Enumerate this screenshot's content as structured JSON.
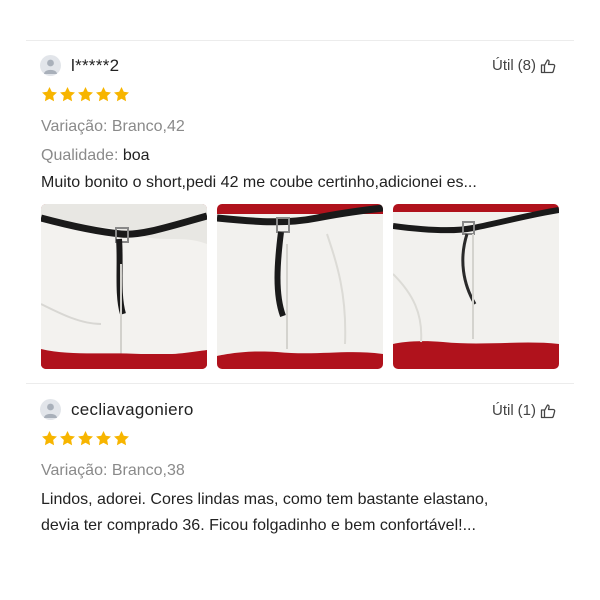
{
  "reviews": [
    {
      "username": "l*****2",
      "helpful_label": "Útil",
      "helpful_count": "(8)",
      "rating": 5,
      "variation_label": "Variação:",
      "variation_value": "Branco,42",
      "quality_label": "Qualidade:",
      "quality_value": "boa",
      "text_lines": [
        "Muito bonito o short,pedi 42 me coube certinho,adicionei es..."
      ],
      "photos": [
        "white-shorts-photo-1",
        "white-shorts-photo-2",
        "white-shorts-photo-3"
      ]
    },
    {
      "username": "cecliavagoniero",
      "helpful_label": "Útil",
      "helpful_count": "(1)",
      "rating": 5,
      "variation_label": "Variação:",
      "variation_value": "Branco,38",
      "text_lines": [
        "Lindos, adorei. Cores lindas mas, como tem bastante elastano,",
        "devia ter comprado 36.  Ficou folgadinho e bem confortável!..."
      ]
    }
  ],
  "colors": {
    "star": "#f7b500",
    "muted_text": "#8a8a8a",
    "divider": "#ececec",
    "photo_background": "#b0121c"
  }
}
